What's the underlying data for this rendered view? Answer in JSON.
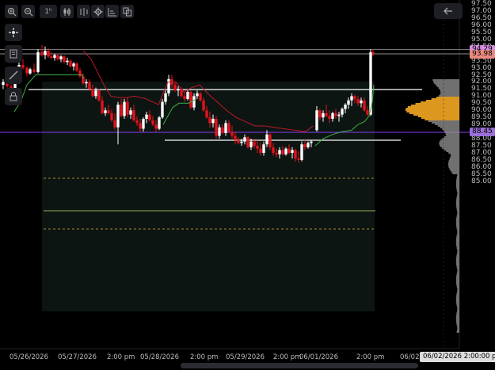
{
  "toolbar": {
    "interval_label": "1ʰ"
  },
  "y_axis": {
    "ticks": [
      "97.50",
      "97.00",
      "96.50",
      "96.00",
      "95.50",
      "95.00",
      "94.50",
      "94.00",
      "93.50",
      "93.00",
      "92.50",
      "92.00",
      "91.50",
      "91.00",
      "90.50",
      "90.00",
      "89.50",
      "89.00",
      "88.50",
      "88.00",
      "87.50",
      "87.00",
      "86.50",
      "86.00",
      "85.50",
      "85.00"
    ]
  },
  "x_axis": {
    "ticks": [
      "05/26/2026",
      "05/27/2026",
      "2:00 pm",
      "05/28/2026",
      "2:00 pm",
      "05/29/2026",
      "2:00 pm",
      "06/01/2026",
      "2:00 pm",
      "06/02"
    ]
  },
  "price_tags": [
    {
      "label": "94.29",
      "color": "#d98ee0",
      "text_color": "#000"
    },
    {
      "label": "93.98",
      "color": "#e88a80",
      "text_color": "#000"
    },
    {
      "label": "88.45",
      "color": "#9b6fd8",
      "text_color": "#000"
    }
  ],
  "crosshair_date": "06/02/2026 2:00:00 pm",
  "colors": {
    "up": "#ffffff",
    "down": "#e3121b",
    "trail_up": "#3cb043",
    "trail_down": "#c0182a",
    "level_line": "#ffffff",
    "dashed": "#d9b43a",
    "purple": "#8a3cf0",
    "volume_profile": "#8c8c8c",
    "value_area": "#e8a020"
  }
}
